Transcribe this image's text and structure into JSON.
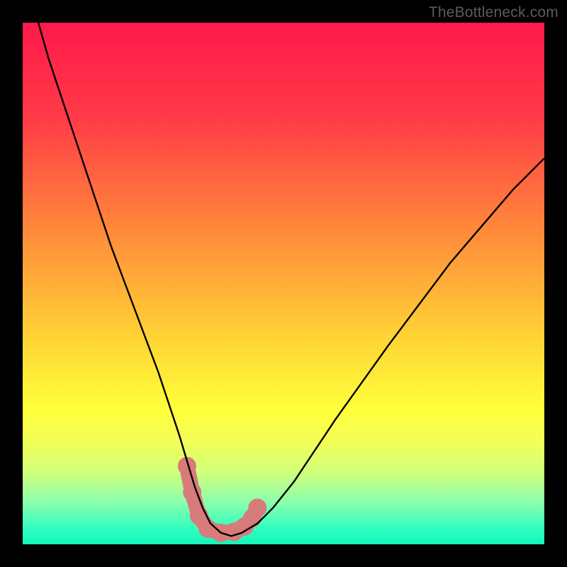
{
  "watermark": "TheBottleneck.com",
  "chart_data": {
    "type": "line",
    "title": "",
    "xlabel": "",
    "ylabel": "",
    "xlim": [
      0,
      100
    ],
    "ylim": [
      0,
      100
    ],
    "gradient_stops": [
      {
        "offset": 0,
        "color": "#ff1a4b"
      },
      {
        "offset": 18,
        "color": "#ff3a47"
      },
      {
        "offset": 40,
        "color": "#ff8a3a"
      },
      {
        "offset": 60,
        "color": "#ffd235"
      },
      {
        "offset": 74,
        "color": "#ffff3a"
      },
      {
        "offset": 80,
        "color": "#f4ff55"
      },
      {
        "offset": 86,
        "color": "#d2ff7a"
      },
      {
        "offset": 92,
        "color": "#8affac"
      },
      {
        "offset": 97,
        "color": "#30ffc0"
      },
      {
        "offset": 100,
        "color": "#14f7b8"
      }
    ],
    "series": [
      {
        "name": "bottleneck-curve",
        "color": "#000000",
        "x": [
          3,
          5,
          8,
          11,
          14,
          17,
          20,
          23,
          26,
          28,
          30,
          31.5,
          33,
          34.5,
          36,
          38,
          40,
          42,
          45,
          48,
          52,
          56,
          60,
          65,
          70,
          76,
          82,
          88,
          94,
          100
        ],
        "y": [
          100,
          93,
          84,
          75,
          66,
          57,
          49,
          41,
          33,
          27,
          21,
          16,
          11,
          7,
          4,
          2.2,
          1.6,
          2.2,
          4,
          7,
          12,
          18,
          24,
          31,
          38,
          46,
          54,
          61,
          68,
          74
        ]
      }
    ],
    "marker_band": {
      "name": "optimal-range",
      "color": "#d77b7b",
      "points": [
        {
          "x": 31.5,
          "y": 15
        },
        {
          "x": 32.5,
          "y": 10
        },
        {
          "x": 33.8,
          "y": 5.5
        },
        {
          "x": 35.5,
          "y": 3
        },
        {
          "x": 38,
          "y": 2.2
        },
        {
          "x": 40.5,
          "y": 2.4
        },
        {
          "x": 42.5,
          "y": 3.4
        },
        {
          "x": 44,
          "y": 5
        },
        {
          "x": 45,
          "y": 7
        }
      ]
    }
  }
}
